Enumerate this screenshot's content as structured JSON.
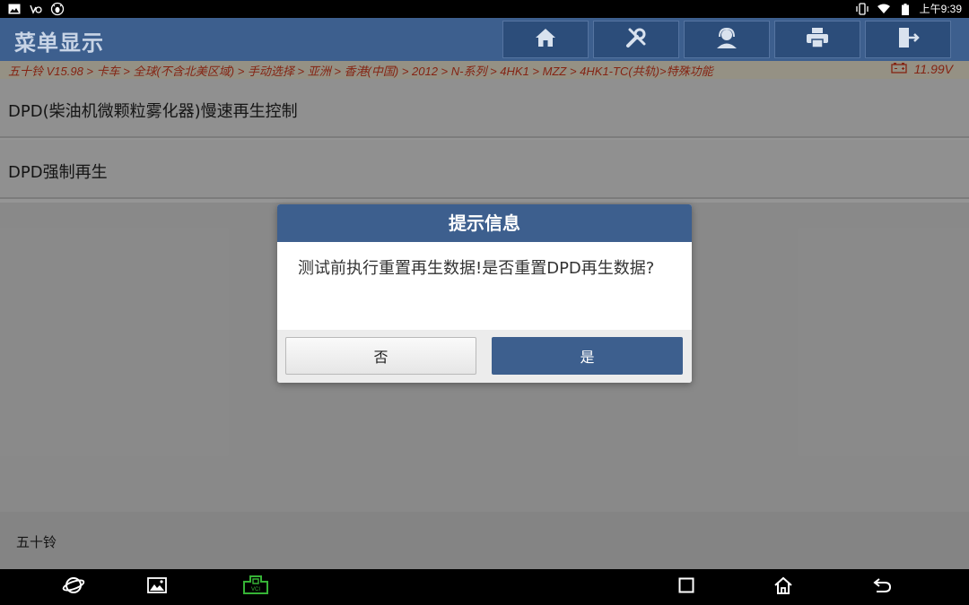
{
  "status_bar": {
    "time": "上午9:39",
    "left_icons": [
      "image-icon",
      "voicemail-icon",
      "bug-icon"
    ],
    "right_icons": [
      "vibrate-icon",
      "wifi-icon",
      "battery-icon"
    ]
  },
  "header": {
    "title": "菜单显示",
    "toolbar": [
      "home-icon",
      "tools-icon",
      "support-icon",
      "print-icon",
      "exit-icon"
    ]
  },
  "breadcrumb": {
    "path": "五十铃 V15.98 > 卡车 > 全球(不含北美区域) > 手动选择 > 亚洲 > 香港(中国) > 2012 > N-系列 > 4HK1 > MZZ > 4HK1-TC(共轨)>特殊功能",
    "voltage": "11.99V"
  },
  "menu": {
    "items": [
      {
        "label": "DPD(柴油机微颗粒雾化器)慢速再生控制"
      },
      {
        "label": "DPD强制再生"
      }
    ]
  },
  "footer": {
    "label": "五十铃"
  },
  "dialog": {
    "title": "提示信息",
    "message": "测试前执行重置再生数据!是否重置DPD再生数据?",
    "no_label": "否",
    "yes_label": "是"
  },
  "nav_bar": {
    "icons": [
      "browser-icon",
      "gallery-icon",
      "vci-icon",
      "recents-icon",
      "home-nav-icon",
      "back-icon"
    ],
    "vci_label": "VCI"
  },
  "colors": {
    "header": "#3d5f8e",
    "breadcrumb_text": "#d63b1f",
    "vci_green": "#36b336"
  }
}
